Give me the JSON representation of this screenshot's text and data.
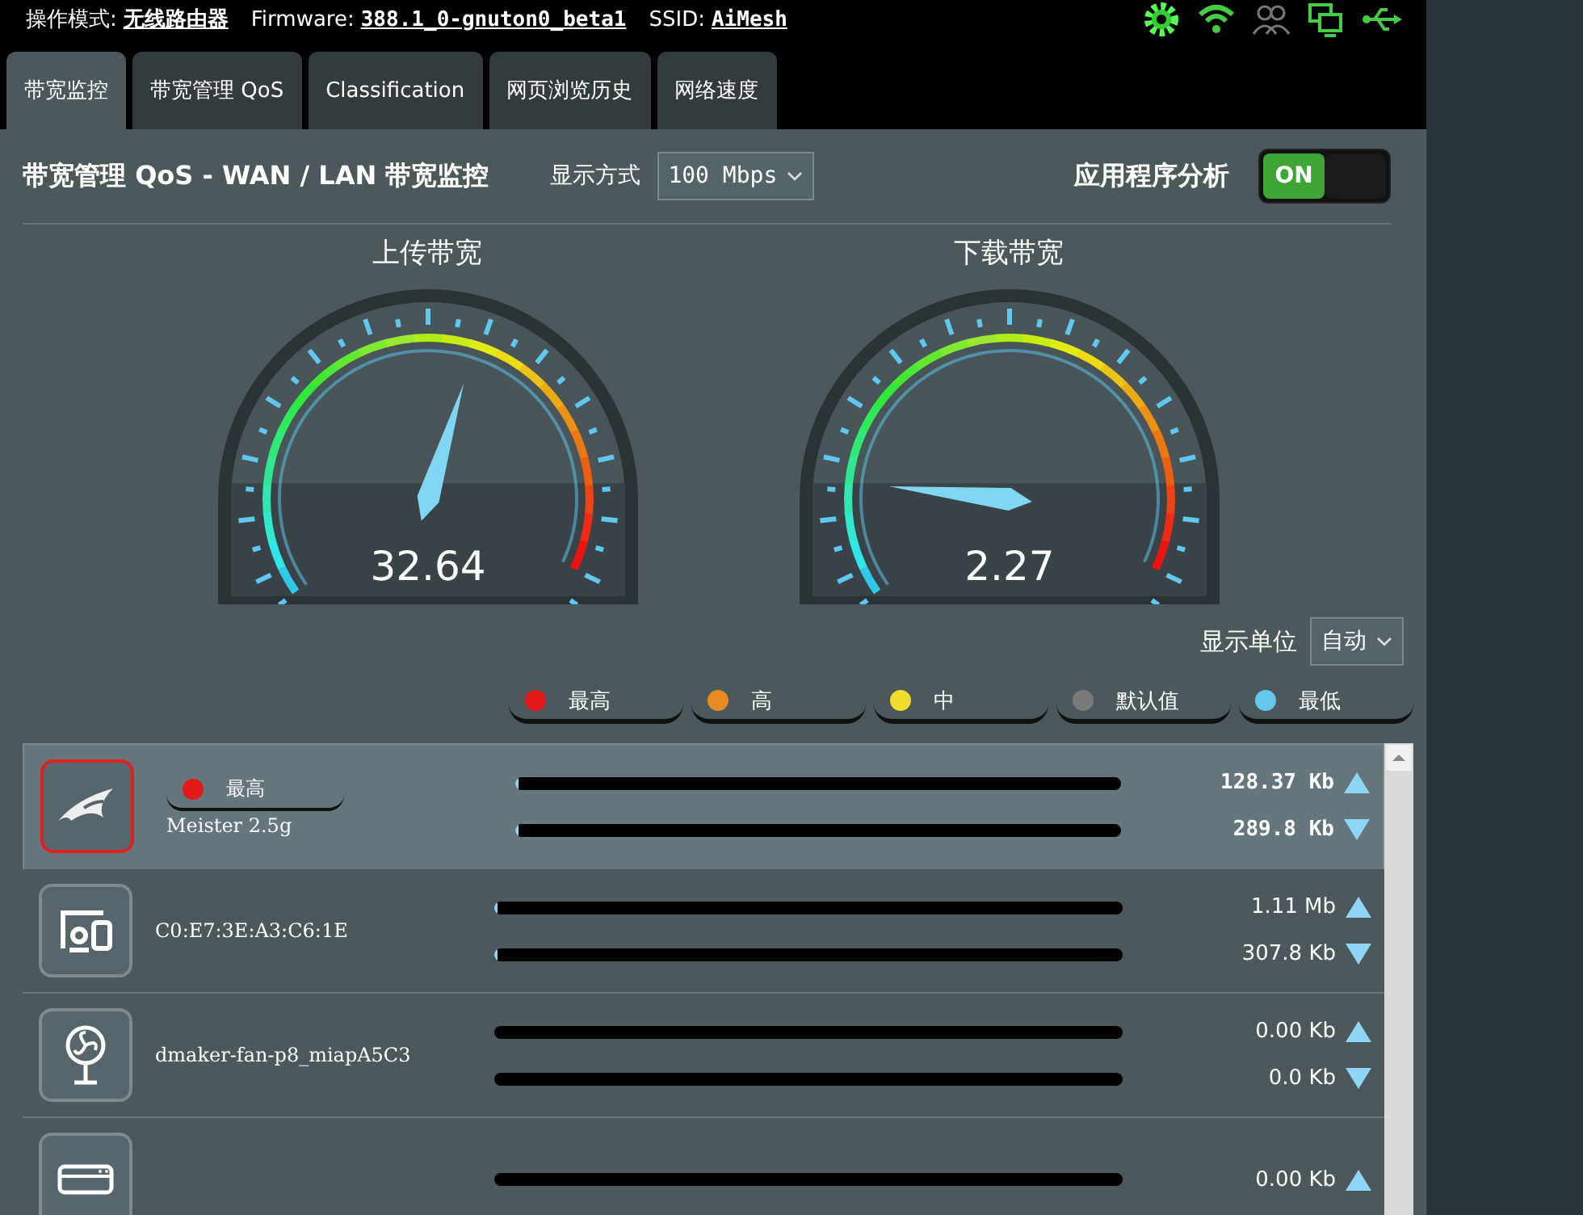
{
  "status": {
    "mode_label": "操作模式:",
    "mode": "无线路由器",
    "firmware_label": "Firmware:",
    "firmware": "388.1_0-gnuton0_beta1",
    "ssid_label": "SSID:",
    "ssid": "AiMesh"
  },
  "tabs": [
    {
      "label": "带宽监控",
      "selected": true
    },
    {
      "label": "带宽管理 QoS",
      "selected": false
    },
    {
      "label": "Classification",
      "selected": false
    },
    {
      "label": "网页浏览历史",
      "selected": false
    },
    {
      "label": "网络速度",
      "selected": false
    }
  ],
  "header": {
    "title": "带宽管理 QoS - WAN / LAN 带宽监控",
    "display_label": "显示方式",
    "display_value": "100 Mbps",
    "analysis_label": "应用程序分析",
    "analysis_toggle": {
      "label": "ON",
      "on": true
    }
  },
  "gauges": [
    {
      "title": "上传带宽",
      "value": "32.64"
    },
    {
      "title": "下载带宽",
      "value": "2.27"
    }
  ],
  "unit": {
    "label": "显示单位",
    "value": "自动"
  },
  "priorities": [
    {
      "label": "最高",
      "color": "#e3191b"
    },
    {
      "label": "高",
      "color": "#e88a22"
    },
    {
      "label": "中",
      "color": "#f0dc2c"
    },
    {
      "label": "默认值",
      "color": "#7a7a7a"
    },
    {
      "label": "最低",
      "color": "#63c8ec"
    }
  ],
  "devices": [
    {
      "kind": "router",
      "name": "Meister 2.5g",
      "selected": true,
      "priority": {
        "label": "最高",
        "color": "#e3191b"
      },
      "upload": {
        "level": 0.005,
        "reading": "128.37 Kb"
      },
      "download": {
        "level": 0.005,
        "reading": "289.8 Kb"
      }
    },
    {
      "kind": "devices",
      "name": "C0:E7:3E:A3:C6:1E",
      "selected": false,
      "upload": {
        "level": 0.005,
        "reading": "1.11 Mb"
      },
      "download": {
        "level": 0.005,
        "reading": "307.8 Kb"
      }
    },
    {
      "kind": "fan",
      "name": "dmaker-fan-p8_miapA5C3",
      "selected": false,
      "upload": {
        "reading": "0.00 Kb"
      },
      "download": {
        "reading": "0.0 Kb"
      }
    },
    {
      "kind": "screen",
      "selected": false,
      "upload": {
        "reading": "0.00 Kb"
      }
    }
  ]
}
